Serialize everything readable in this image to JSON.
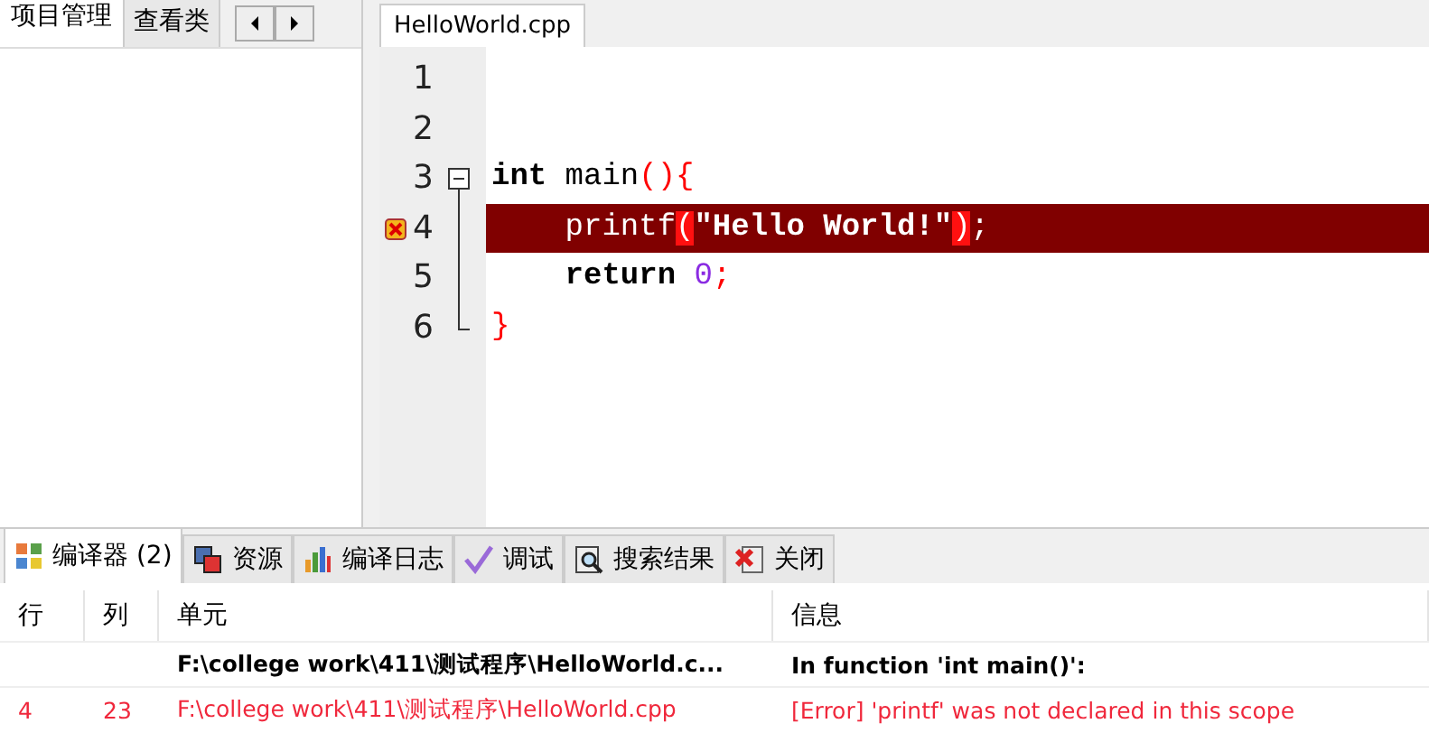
{
  "left_panel": {
    "tabs": [
      {
        "label": "项目管理",
        "selected": true
      },
      {
        "label": "查看类",
        "selected": false
      }
    ]
  },
  "editor": {
    "tabs": [
      {
        "label": "HelloWorld.cpp",
        "selected": true
      }
    ],
    "lines": [
      {
        "number": "1"
      },
      {
        "number": "2"
      },
      {
        "number": "3",
        "expanded": true,
        "tokens": [
          {
            "text": "int",
            "kind": "keyword"
          },
          {
            "text": " main",
            "kind": "ident"
          },
          {
            "text": "()",
            "kind": "punct"
          },
          {
            "text": "{",
            "kind": "punct"
          }
        ]
      },
      {
        "number": "4",
        "error": true,
        "tokens": [
          {
            "text": "    printf",
            "kind": "ident"
          },
          {
            "text": "(",
            "kind": "punct",
            "matched": true
          },
          {
            "text": "\"Hello World!\"",
            "kind": "string"
          },
          {
            "text": ")",
            "kind": "punct",
            "matched": true
          },
          {
            "text": ";",
            "kind": "punct"
          }
        ]
      },
      {
        "number": "5",
        "tokens": [
          {
            "text": "    return",
            "kind": "keyword"
          },
          {
            "text": " 0",
            "kind": "number"
          },
          {
            "text": ";",
            "kind": "punct"
          }
        ]
      },
      {
        "number": "6",
        "tokens": [
          {
            "text": "}",
            "kind": "punct"
          }
        ]
      }
    ]
  },
  "bottom_panel": {
    "tabs": [
      {
        "label": "编译器 (2)",
        "selected": true
      },
      {
        "label": "资源",
        "selected": false
      },
      {
        "label": "编译日志",
        "selected": false
      },
      {
        "label": "调试",
        "selected": false
      },
      {
        "label": "搜索结果",
        "selected": false
      },
      {
        "label": "关闭",
        "selected": false
      }
    ],
    "table": {
      "columns": [
        "行",
        "列",
        "单元",
        "信息"
      ],
      "rows": [
        {
          "kind": "info",
          "cells": [
            "",
            "",
            "F:\\college work\\411\\测试程序\\HelloWorld.c...",
            "In function 'int main()':"
          ]
        },
        {
          "kind": "error",
          "cells": [
            "4",
            "23",
            "F:\\college work\\411\\测试程序\\HelloWorld.cpp",
            "[Error] 'printf' was not declared in this scope"
          ]
        }
      ]
    }
  }
}
